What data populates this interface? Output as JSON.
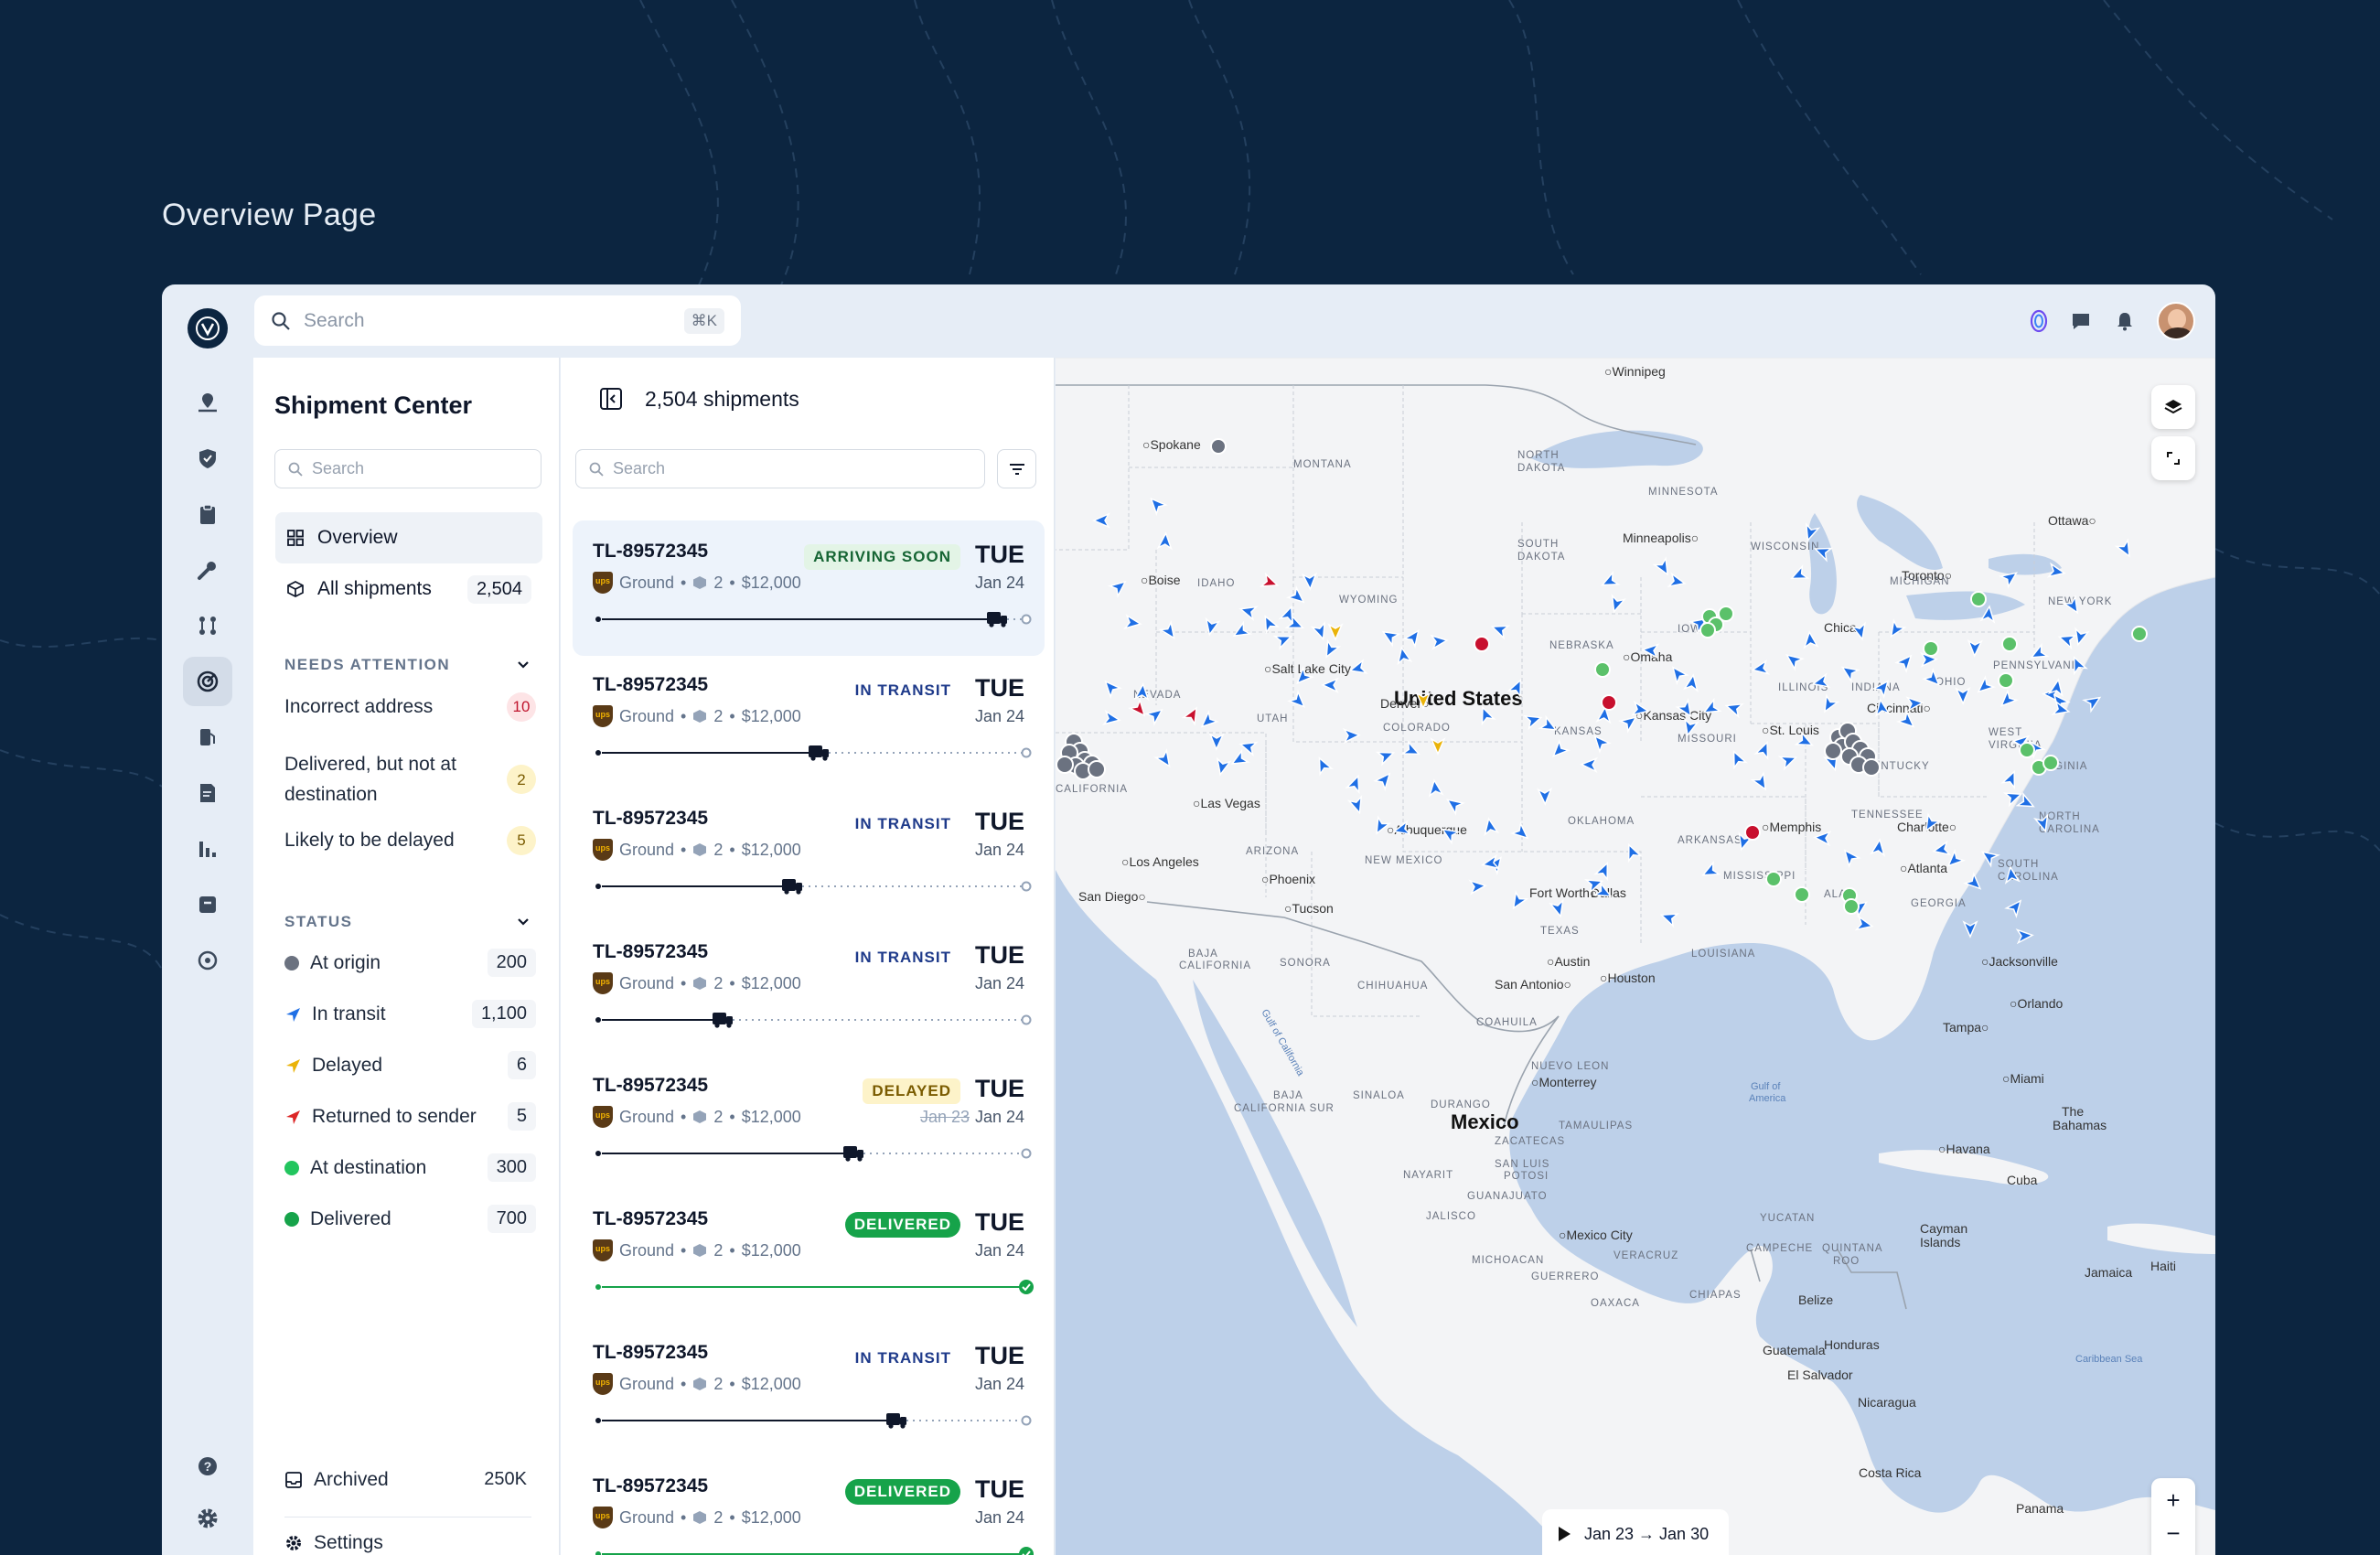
{
  "page": {
    "title": "Overview Page"
  },
  "topbar": {
    "search_placeholder": "Search",
    "shortcut": "⌘K"
  },
  "rail": {
    "icons": [
      "logo-icon",
      "map-pin-icon",
      "shield-icon",
      "clipboard-icon",
      "wrench-icon",
      "route-icon",
      "radar-icon",
      "fuel-icon",
      "document-icon",
      "bar-chart-icon",
      "archive-icon",
      "target-icon",
      "help-icon",
      "gear-icon"
    ]
  },
  "sidebar": {
    "title": "Shipment Center",
    "search_placeholder": "Search",
    "nav": [
      {
        "label": "Overview"
      },
      {
        "label": "All shipments",
        "count": "2,504"
      }
    ],
    "attention_title": "NEEDS ATTENTION",
    "attention": [
      {
        "label": "Incorrect address",
        "count": "10"
      },
      {
        "label": "Delivered, but not at",
        "label2": "destination",
        "count": "2"
      },
      {
        "label": "Likely to be delayed",
        "count": "5"
      }
    ],
    "status_title": "STATUS",
    "status": [
      {
        "label": "At origin",
        "count": "200",
        "color": "#6b7280"
      },
      {
        "label": "In transit",
        "count": "1,100",
        "color": "#1f6fe5"
      },
      {
        "label": "Delayed",
        "count": "6",
        "color": "#eab308"
      },
      {
        "label": "Returned to sender",
        "count": "5",
        "color": "#dc2626"
      },
      {
        "label": "At destination",
        "count": "300",
        "color": "#22c55e"
      },
      {
        "label": "Delivered",
        "count": "700",
        "color": "#16a34a"
      }
    ],
    "archived": {
      "label": "Archived",
      "count": "250K"
    },
    "settings": {
      "label": "Settings"
    }
  },
  "list": {
    "header": "2,504 shipments",
    "search_placeholder": "Search",
    "shipments": [
      {
        "id": "TL-89572345",
        "mode": "Ground",
        "pieces": "2",
        "value": "$12,000",
        "status": "ARRIVING SOON",
        "day": "TUE",
        "date": "Jan 24",
        "progress": 0.93
      },
      {
        "id": "TL-89572345",
        "mode": "Ground",
        "pieces": "2",
        "value": "$12,000",
        "status": "IN TRANSIT",
        "day": "TUE",
        "date": "Jan 24",
        "progress": 0.52
      },
      {
        "id": "TL-89572345",
        "mode": "Ground",
        "pieces": "2",
        "value": "$12,000",
        "status": "IN TRANSIT",
        "day": "TUE",
        "date": "Jan 24",
        "progress": 0.46
      },
      {
        "id": "TL-89572345",
        "mode": "Ground",
        "pieces": "2",
        "value": "$12,000",
        "status": "IN TRANSIT",
        "day": "TUE",
        "date": "Jan 24",
        "progress": 0.3
      },
      {
        "id": "TL-89572345",
        "mode": "Ground",
        "pieces": "2",
        "value": "$12,000",
        "status": "DELAYED",
        "day": "TUE",
        "date": "Jan 24",
        "old_date": "Jan 23",
        "progress": 0.6
      },
      {
        "id": "TL-89572345",
        "mode": "Ground",
        "pieces": "2",
        "value": "$12,000",
        "status": "DELIVERED",
        "day": "TUE",
        "date": "Jan 24",
        "progress": 1.0
      },
      {
        "id": "TL-89572345",
        "mode": "Ground",
        "pieces": "2",
        "value": "$12,000",
        "status": "IN TRANSIT",
        "day": "TUE",
        "date": "Jan 24",
        "progress": 0.7
      },
      {
        "id": "TL-89572345",
        "mode": "Ground",
        "pieces": "2",
        "value": "$12,000",
        "status": "DELIVERED",
        "day": "TUE",
        "date": "Jan 24",
        "progress": 1.0
      }
    ]
  },
  "map": {
    "labels": [
      "United States",
      "Mexico",
      "Denver",
      "Kansas City",
      "St. Louis",
      "Minneapolis",
      "Chicago",
      "Toronto",
      "Ottawa",
      "Salt Lake City",
      "Las Vegas",
      "Los Angeles",
      "San Diego",
      "Phoenix",
      "Tucson",
      "Albuquerque",
      "Dallas",
      "Fort Worth",
      "Austin",
      "San Antonio",
      "Houston",
      "Memphis",
      "Atlanta",
      "Charlotte",
      "Jacksonville",
      "Orlando",
      "Tampa",
      "Miami",
      "Havana",
      "Cuba",
      "Monterrey",
      "Mexico City",
      "Guatemala",
      "Honduras",
      "Nicaragua",
      "Costa Rica",
      "Panama",
      "Jamaica",
      "Haiti",
      "Belize",
      "El Salvador",
      "Cincinnati",
      "Winnipeg",
      "Spokane",
      "Boise",
      "Omaha",
      "Cayman Islands",
      "The Bahamas"
    ],
    "states": [
      "MONTANA",
      "NORTH DAKOTA",
      "SOUTH DAKOTA",
      "MINNESOTA",
      "WISCONSIN",
      "MICHIGAN",
      "IDAHO",
      "WYOMING",
      "NEBRASKA",
      "IOWA",
      "ILLINOIS",
      "INDIANA",
      "OHIO",
      "PENNSYLVANIA",
      "NEW YORK",
      "NEVADA",
      "UTAH",
      "COLORADO",
      "KANSAS",
      "MISSOURI",
      "KENTUCKY",
      "WEST VIRGINIA",
      "VIRGINIA",
      "CALIFORNIA",
      "ARIZONA",
      "NEW MEXICO",
      "OKLAHOMA",
      "ARKANSAS",
      "TENNESSEE",
      "NORTH CAROLINA",
      "SOUTH CAROLINA",
      "GEORGIA",
      "ALABAMA",
      "MISSISSIPPI",
      "LOUISIANA",
      "TEXAS",
      "CHIHUAHUA",
      "SONORA",
      "COAHUILA",
      "NUEVO LEON",
      "DURANGO",
      "SINALOA",
      "TAMAULIPAS",
      "ZACATECAS",
      "SAN LUIS POTOSI",
      "JALISCO",
      "GUANAJUATO",
      "OAXACA",
      "CHIAPAS",
      "YUCATAN",
      "CAMPECHE",
      "QUINTANA ROO",
      "VERACRUZ",
      "GUERRERO",
      "MICHOACAN",
      "NAYARIT",
      "BAJA CALIFORNIA",
      "BAJA CALIFORNIA SUR",
      "KENTUCKY"
    ],
    "water": [
      "Gulf of America",
      "Caribbean Sea",
      "Gulf of California"
    ],
    "play_range": "Jan 23 → Jan 30"
  }
}
